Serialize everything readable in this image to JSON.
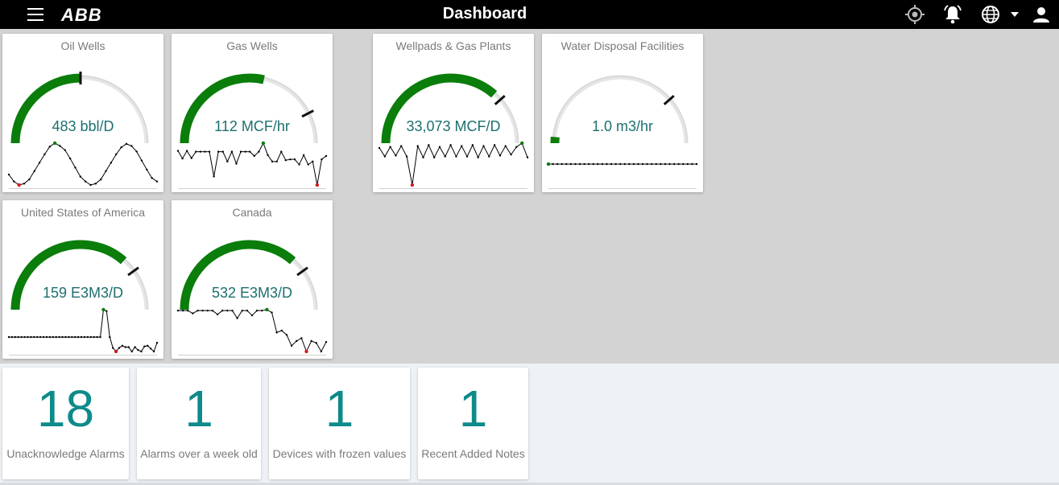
{
  "header": {
    "logo": "ABB",
    "title": "Dashboard",
    "icons": [
      "menu-icon",
      "location-icon",
      "bell-icon",
      "globe-icon",
      "caret-down-icon",
      "user-icon"
    ]
  },
  "colors": {
    "gauge_fill": "#0a7d0a",
    "gauge_track": "#e6e6e6",
    "reading": "#1d6f6f",
    "kpi_number": "#0e8a8a",
    "spark_min": "#d11a1a",
    "spark_max": "#0a7d0a"
  },
  "gauges": [
    {
      "title": "Oil Wells",
      "value": "483 bbl/D",
      "fill": 0.5,
      "marker": 0.5,
      "spark": [
        55,
        45,
        40,
        42,
        48,
        60,
        72,
        84,
        95,
        100,
        96,
        90,
        78,
        65,
        52,
        45,
        40,
        42,
        48,
        60,
        72,
        84,
        94,
        99,
        96,
        88,
        75,
        62,
        50,
        45
      ]
    },
    {
      "title": "Gas Wells",
      "value": "112 MCF/hr",
      "fill": 0.57,
      "marker": 0.85,
      "spark": [
        80,
        62,
        80,
        63,
        78,
        78,
        78,
        78,
        20,
        78,
        78,
        55,
        78,
        50,
        78,
        78,
        78,
        68,
        78,
        98,
        70,
        55,
        55,
        78,
        58,
        60,
        60,
        48,
        70,
        48,
        55,
        0,
        60,
        68
      ]
    },
    {
      "title": "Wellpads & Gas Plants",
      "value": "33,073 MCF/D",
      "fill": 0.73,
      "marker": 0.77,
      "spark": [
        78,
        60,
        80,
        62,
        82,
        60,
        0,
        82,
        58,
        84,
        58,
        80,
        60,
        84,
        60,
        82,
        60,
        84,
        58,
        82,
        60,
        84,
        62,
        82,
        64,
        80,
        88,
        58
      ]
    },
    {
      "title": "Water Disposal Facilities",
      "value": "1.0 m3/hr",
      "fill": 0.03,
      "marker": 0.77,
      "spark": [
        30,
        30,
        30,
        30,
        30,
        30,
        30,
        30,
        30,
        30,
        30,
        30,
        30,
        30,
        30,
        30,
        30,
        30,
        30,
        30,
        30,
        30,
        30,
        30,
        30,
        30,
        30,
        30,
        30,
        30,
        30,
        30,
        30,
        30
      ]
    },
    {
      "title": "United States of America",
      "value": "159 E3M3/D",
      "fill": 0.73,
      "marker": 0.8,
      "spark": [
        20,
        20,
        20,
        20,
        20,
        20,
        20,
        20,
        20,
        20,
        20,
        20,
        20,
        20,
        20,
        20,
        20,
        20,
        20,
        20,
        20,
        20,
        20,
        20,
        20,
        20,
        20,
        20,
        20,
        20,
        58,
        56,
        20,
        5,
        0,
        5,
        8,
        6,
        6,
        0,
        6,
        2,
        0,
        7,
        8,
        4,
        0,
        12
      ]
    },
    {
      "title": "Canada",
      "value": "532 E3M3/D",
      "fill": 0.73,
      "marker": 0.8,
      "spark": [
        86,
        86,
        86,
        80,
        86,
        86,
        86,
        86,
        78,
        86,
        86,
        86,
        70,
        86,
        86,
        76,
        86,
        86,
        88,
        82,
        40,
        44,
        35,
        12,
        22,
        28,
        0,
        22,
        18,
        0,
        20
      ]
    }
  ],
  "kpis": [
    {
      "value": "18",
      "label": "Unacknowledge Alarms"
    },
    {
      "value": "1",
      "label": "Alarms over a week old"
    },
    {
      "value": "1",
      "label": "Devices with frozen values"
    },
    {
      "value": "1",
      "label": "Recent Added Notes"
    }
  ]
}
